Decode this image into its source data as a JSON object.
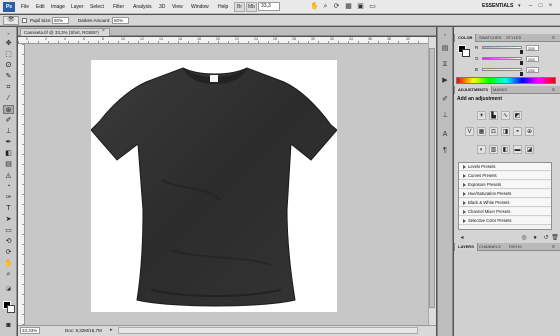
{
  "menubar": {
    "logo": "Ps",
    "items": [
      "File",
      "Edit",
      "Image",
      "Layer",
      "Select",
      "Filter",
      "Analysis",
      "3D",
      "View",
      "Window",
      "Help"
    ],
    "zoom": "33,3",
    "workspace": "ESSENTIALS",
    "workspace_arrow": "▾"
  },
  "options": {
    "pupil_label": "Pupil Size:",
    "pupil_value": "50%",
    "darken_label": "Darken Amount:",
    "darken_value": "50%"
  },
  "document": {
    "tab_title": "Camiseta.tif @ 33,3% (Shirt, RGB/8*)",
    "close": "×",
    "ruler_top": [
      "0",
      "2",
      "4",
      "6",
      "8",
      "10",
      "12",
      "14",
      "16",
      "18",
      "20",
      "22",
      "24",
      "26",
      "28",
      "30",
      "32",
      "34",
      "36",
      "38",
      "40"
    ],
    "zoom_status": "33,33%",
    "doc_size": "Doc: 9,32M/16,7M"
  },
  "panels": {
    "color_tabs": [
      "COLOR",
      "SWATCHES",
      "STYLES"
    ],
    "channels": [
      {
        "label": "R",
        "value": "255",
        "level": 1.0,
        "color": "#ff0000"
      },
      {
        "label": "G",
        "value": "255",
        "level": 1.0,
        "color": "#00ff00"
      },
      {
        "label": "B",
        "value": "255",
        "level": 1.0,
        "color": "#0000ff"
      }
    ],
    "adjust_tabs": [
      "ADJUSTMENTS",
      "MASKS"
    ],
    "adjust_title": "Add an adjustment",
    "presets": [
      "Levels Presets",
      "Curves Presets",
      "Exposure Presets",
      "Hue/Saturation Presets",
      "Black & White Presets",
      "Channel Mixer Presets",
      "Selective Color Presets"
    ],
    "layers_tabs": [
      "LAYERS",
      "CHANNELS",
      "PATHS"
    ]
  },
  "colors": {
    "fg": "#000000",
    "bg": "#ffffff",
    "shirt": "#333333"
  }
}
